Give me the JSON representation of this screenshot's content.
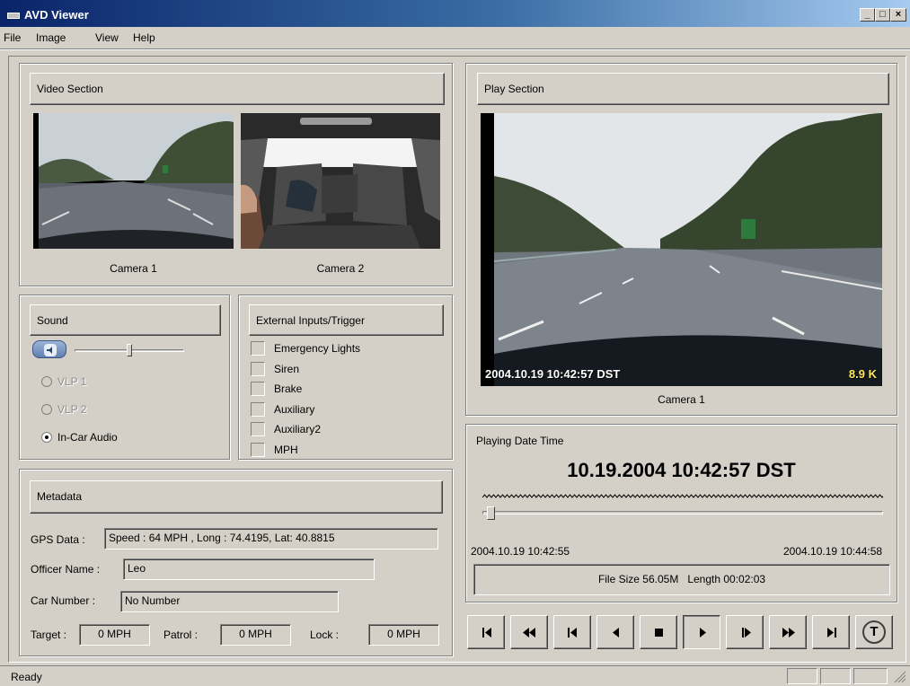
{
  "window": {
    "title": "AVD Viewer",
    "minimize": "_",
    "maximize": "□",
    "close": "×"
  },
  "menu": [
    "File",
    "Image",
    "View",
    "Help"
  ],
  "video_section": {
    "header": "Video Section",
    "cam1": "Camera 1",
    "cam2": "Camera 2"
  },
  "sound": {
    "header": "Sound",
    "volume": 0.5,
    "options": [
      {
        "label": "VLP 1",
        "selected": false,
        "enabled": false
      },
      {
        "label": "VLP 2",
        "selected": false,
        "enabled": false
      },
      {
        "label": "In-Car Audio",
        "selected": true,
        "enabled": true
      }
    ]
  },
  "external": {
    "header": "External Inputs/Trigger",
    "items": [
      "Emergency Lights",
      "Siren",
      "Brake",
      "Auxiliary",
      "Auxiliary2",
      "MPH"
    ]
  },
  "metadata": {
    "header": "Metadata",
    "gps_label": "GPS Data :",
    "gps_value": "Speed : 64 MPH , Long : 74.4195, Lat: 40.8815",
    "officer_label": "Officer Name :",
    "officer_value": "Leo",
    "car_label": "Car Number :",
    "car_value": "No Number",
    "target_label": "Target :",
    "target_value": "0 MPH",
    "patrol_label": "Patrol :",
    "patrol_value": "0 MPH",
    "lock_label": "Lock :",
    "lock_value": "0 MPH"
  },
  "play_section": {
    "header": "Play Section",
    "overlay_time": "2004.10.19 10:42:57 DST",
    "overlay_rate": "8.9 K",
    "camera": "Camera 1"
  },
  "playing": {
    "label": "Playing Date Time",
    "datetime": "10.19.2004 10:42:57 DST",
    "start": "2004.10.19 10:42:55",
    "end": "2004.10.19 10:44:58",
    "position": 0.02,
    "info": "File Size 56.05M   Length 00:02:03"
  },
  "controls": [
    "go-start",
    "fast-rewind",
    "step-back",
    "play-reverse",
    "stop",
    "play",
    "step-forward",
    "fast-forward",
    "go-end",
    "timestamp"
  ],
  "controls_t_label": "T",
  "status": {
    "text": "Ready"
  }
}
